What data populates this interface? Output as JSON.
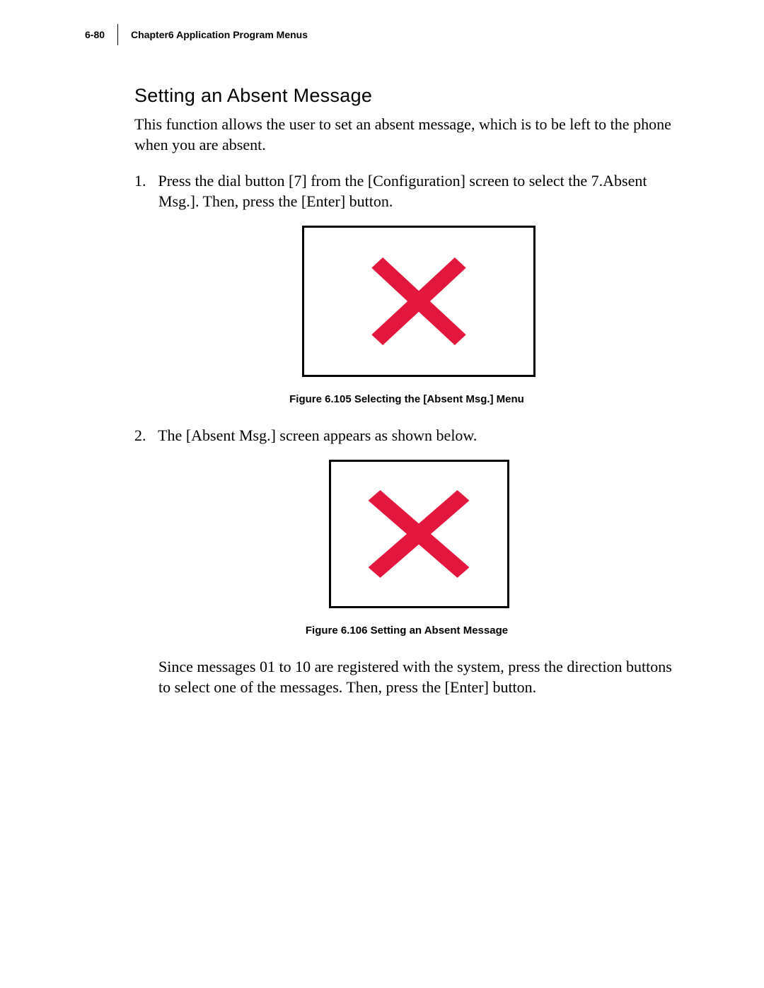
{
  "header": {
    "page_number": "6-80",
    "chapter": "Chapter6  Application Program Menus"
  },
  "section": {
    "title": "Setting an Absent Message",
    "intro": "This function allows the user to set an absent message, which is to be left to the phone when you are absent."
  },
  "steps": [
    {
      "text": "Press the dial button [7] from the [Configuration] screen to select the 7.Absent Msg.]. Then, press the [Enter] button."
    },
    {
      "text": "The [Absent Msg.] screen appears as shown below."
    }
  ],
  "figures": [
    {
      "caption": "Figure 6.105 Selecting the [Absent Msg.] Menu",
      "icon_color": "#e3163d"
    },
    {
      "caption": "Figure 6.106 Setting an Absent Message",
      "icon_color": "#e3163d"
    }
  ],
  "trailing": "Since messages 01 to 10 are registered with the system, press the direction buttons to select one of the messages. Then, press the [Enter] button."
}
